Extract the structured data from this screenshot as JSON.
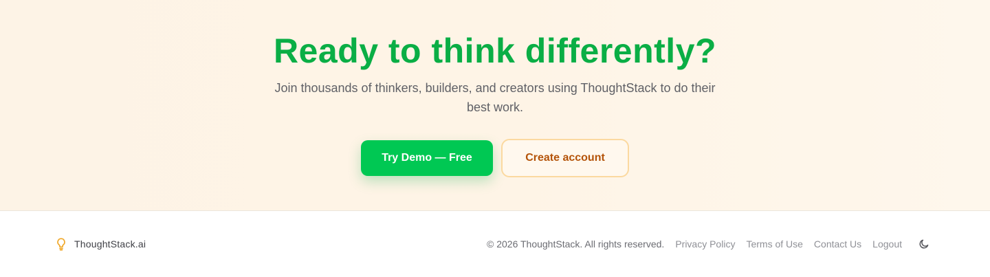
{
  "cta": {
    "title": "Ready to think differently?",
    "subtitle": "Join thousands of thinkers, builders, and creators using ThoughtStack to do their best work.",
    "primary_button": "Try Demo — Free",
    "secondary_button": "Create account"
  },
  "footer": {
    "brand_icon": "lightbulb-icon",
    "brand_name": "ThoughtStack.ai",
    "copyright": "© 2026 ThoughtStack. All rights reserved.",
    "links": [
      {
        "label": "Privacy Policy"
      },
      {
        "label": "Terms of Use"
      },
      {
        "label": "Contact Us"
      },
      {
        "label": "Logout"
      }
    ],
    "theme_toggle_icon": "moon-icon"
  },
  "colors": {
    "brand_green": "#0aae45",
    "button_green": "#00c853",
    "accent_orange": "#b45309",
    "bulb_amber": "#f0a82a"
  }
}
